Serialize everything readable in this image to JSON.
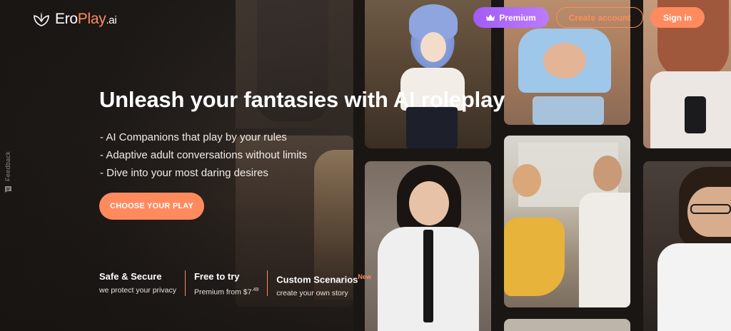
{
  "header": {
    "logo": {
      "ero": "Ero",
      "play": "Play",
      "ai": ".ai"
    },
    "premium_label": "Premium",
    "create_account_label": "Create account",
    "sign_in_label": "Sign in"
  },
  "hero": {
    "title": "Unleash your fantasies with AI roleplay",
    "bullets": [
      "- AI Companions that play by your rules",
      "- Adaptive adult conversations without limits",
      "- Dive into your most daring desires"
    ],
    "cta_label": "CHOOSE YOUR PLAY"
  },
  "features": [
    {
      "title": "Safe & Secure",
      "subtitle": "we protect your privacy"
    },
    {
      "title": "Free to try",
      "subtitle_prefix": "Premium from $7",
      "subtitle_sup": ".49"
    },
    {
      "title": "Custom Scenarios",
      "badge": "New",
      "subtitle": "create your own story"
    }
  ],
  "feedback": {
    "label": "Feedback"
  },
  "colors": {
    "accent": "#ff8a5e",
    "premium": "#a25cf5",
    "background": "#1a1614"
  },
  "icons": [
    "leaf-logo-icon",
    "crown-icon",
    "chat-bubble-icon"
  ]
}
